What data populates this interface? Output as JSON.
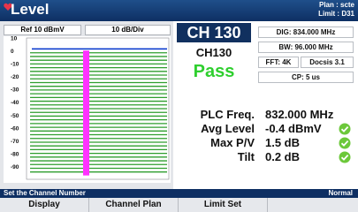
{
  "header": {
    "title": "Level",
    "plan_line1": "Plan : scte",
    "plan_line2": "Limit : D31",
    "icon": "heart-icon"
  },
  "spectrum": {
    "ref_label": "Ref 10 dBmV",
    "scale_label": "10 dB/Div"
  },
  "chart_data": {
    "type": "bar",
    "y_ticks": [
      "10",
      "0",
      "-10",
      "-20",
      "-30",
      "-40",
      "-50",
      "-60",
      "-70",
      "-80",
      "-90"
    ],
    "ylim": [
      -100,
      10
    ],
    "grid": true,
    "colors": {
      "trace": "#0033cc",
      "bars": "#2e9e2e",
      "plc_marker": "#ff33ff"
    }
  },
  "channel": {
    "badge": "CH 130",
    "name": "CH130",
    "result": "Pass",
    "dig_freq": "DIG: 834.000 MHz",
    "bandwidth": "BW: 96.000 MHz",
    "fft": "FFT: 4K",
    "docsis": "Docsis 3.1",
    "cp": "CP: 5 us"
  },
  "measurements": [
    {
      "label": "PLC Freq.",
      "value": "832.000 MHz",
      "check": false
    },
    {
      "label": "Avg Level",
      "value": "-0.4 dBmV",
      "check": true
    },
    {
      "label": "Max P/V",
      "value": "1.5 dB",
      "check": true
    },
    {
      "label": "Tilt",
      "value": "0.2 dB",
      "check": true
    }
  ],
  "status": {
    "message": "Set the Channel Number",
    "mode": "Normal"
  },
  "softkeys": [
    "Display",
    "Channel Plan",
    "Limit Set",
    ""
  ]
}
